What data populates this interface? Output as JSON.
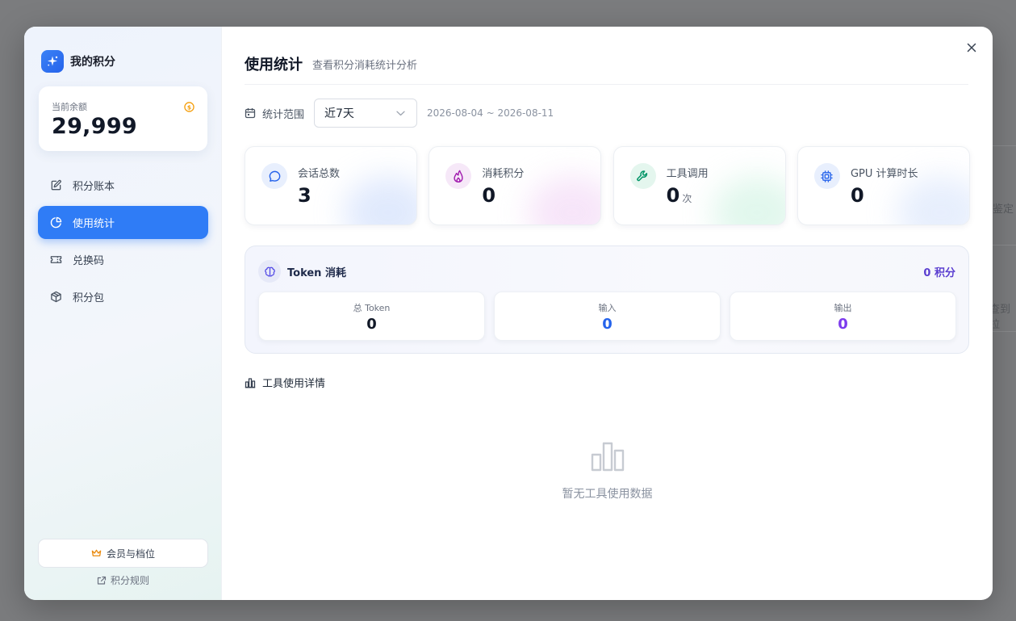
{
  "background": {
    "fragments": [
      "鉴定",
      "查到拉"
    ]
  },
  "sidebar": {
    "brand_title": "我的积分",
    "balance_label": "当前余额",
    "balance_value": "29,999",
    "nav": [
      {
        "label": "积分账本",
        "icon": "edit-icon",
        "active": false
      },
      {
        "label": "使用统计",
        "icon": "pie-chart-icon",
        "active": true
      },
      {
        "label": "兑换码",
        "icon": "ticket-icon",
        "active": false
      },
      {
        "label": "积分包",
        "icon": "package-icon",
        "active": false
      }
    ],
    "member_button": "会员与档位",
    "rules_link": "积分规则"
  },
  "main": {
    "title": "使用统计",
    "subtitle": "查看积分消耗统计分析",
    "range_label": "统计范围",
    "range_selected": "近7天",
    "range_dates": "2026-08-04 ~ 2026-08-11",
    "stats": [
      {
        "label": "会话总数",
        "value": "3",
        "unit": "",
        "icon": "message-icon",
        "color": "#2563eb"
      },
      {
        "label": "消耗积分",
        "value": "0",
        "unit": "",
        "icon": "flame-icon",
        "color": "#a21caf"
      },
      {
        "label": "工具调用",
        "value": "0",
        "unit": "次",
        "icon": "wrench-icon",
        "color": "#059669"
      },
      {
        "label": "GPU 计算时长",
        "value": "0",
        "unit": "",
        "icon": "cpu-icon",
        "color": "#2563eb"
      }
    ],
    "token": {
      "title": "Token 消耗",
      "total": "0 积分",
      "boxes": [
        {
          "label": "总 Token",
          "value": "0",
          "color": "#111827"
        },
        {
          "label": "输入",
          "value": "0",
          "color": "#2563eb"
        },
        {
          "label": "输出",
          "value": "0",
          "color": "#7c3aed"
        }
      ]
    },
    "detail_title": "工具使用详情",
    "empty_text": "暂无工具使用数据"
  },
  "colors": {
    "accent": "#2f7cf6",
    "token_total": "#5b3fd0"
  }
}
